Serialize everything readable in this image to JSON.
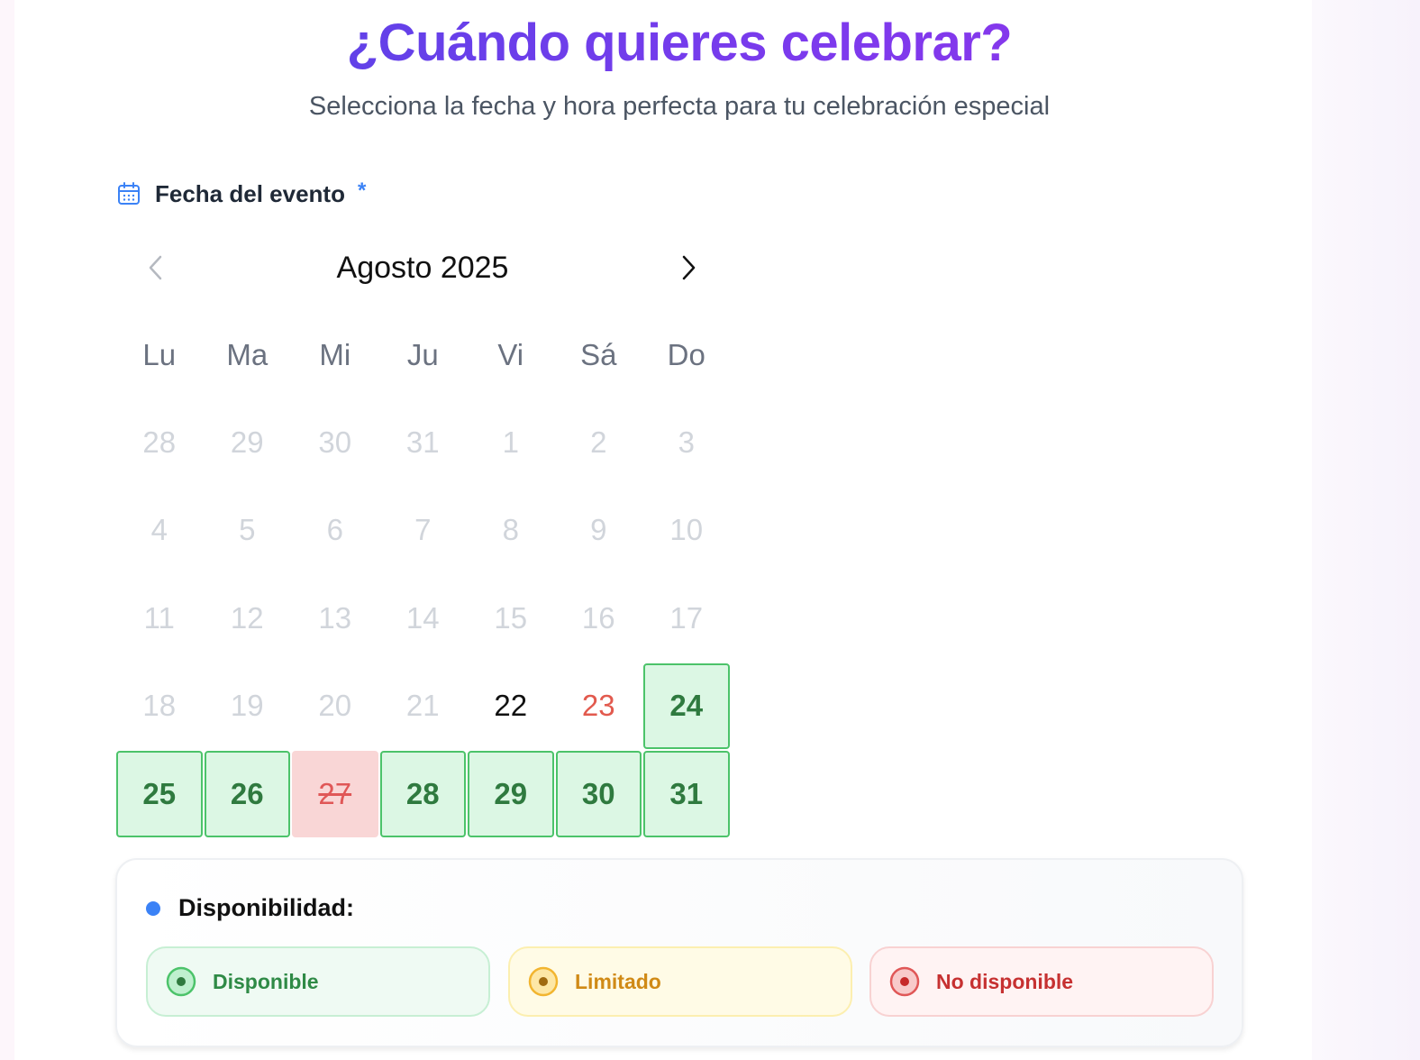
{
  "header": {
    "title": "¿Cuándo quieres celebrar?",
    "subtitle": "Selecciona la fecha y hora perfecta para tu celebración especial"
  },
  "date_field": {
    "icon": "calendar-icon",
    "label": "Fecha del evento",
    "required_marker": "*"
  },
  "calendar": {
    "month_label": "Agosto 2025",
    "prev_icon": "chevron-left-icon",
    "next_icon": "chevron-right-icon",
    "weekdays": [
      "Lu",
      "Ma",
      "Mi",
      "Ju",
      "Vi",
      "Sá",
      "Do"
    ],
    "days": [
      {
        "label": "28",
        "state": "past"
      },
      {
        "label": "29",
        "state": "past"
      },
      {
        "label": "30",
        "state": "past"
      },
      {
        "label": "31",
        "state": "past"
      },
      {
        "label": "1",
        "state": "past"
      },
      {
        "label": "2",
        "state": "past"
      },
      {
        "label": "3",
        "state": "past"
      },
      {
        "label": "4",
        "state": "past"
      },
      {
        "label": "5",
        "state": "past"
      },
      {
        "label": "6",
        "state": "past"
      },
      {
        "label": "7",
        "state": "past"
      },
      {
        "label": "8",
        "state": "past"
      },
      {
        "label": "9",
        "state": "past"
      },
      {
        "label": "10",
        "state": "past"
      },
      {
        "label": "11",
        "state": "past"
      },
      {
        "label": "12",
        "state": "past"
      },
      {
        "label": "13",
        "state": "past"
      },
      {
        "label": "14",
        "state": "past"
      },
      {
        "label": "15",
        "state": "past"
      },
      {
        "label": "16",
        "state": "past"
      },
      {
        "label": "17",
        "state": "past"
      },
      {
        "label": "18",
        "state": "past"
      },
      {
        "label": "19",
        "state": "past"
      },
      {
        "label": "20",
        "state": "past"
      },
      {
        "label": "21",
        "state": "past"
      },
      {
        "label": "22",
        "state": "today"
      },
      {
        "label": "23",
        "state": "weekend-red"
      },
      {
        "label": "24",
        "state": "available"
      },
      {
        "label": "25",
        "state": "available"
      },
      {
        "label": "26",
        "state": "available"
      },
      {
        "label": "27",
        "state": "unavailable"
      },
      {
        "label": "28",
        "state": "available"
      },
      {
        "label": "29",
        "state": "available"
      },
      {
        "label": "30",
        "state": "available"
      },
      {
        "label": "31",
        "state": "available"
      }
    ]
  },
  "legend": {
    "title": "Disponibilidad:",
    "items": [
      {
        "label": "Disponible",
        "color": "#4cc36a"
      },
      {
        "label": "Limitado",
        "color": "#f2b530"
      },
      {
        "label": "No disponible",
        "color": "#e05757"
      }
    ]
  },
  "colors": {
    "title_gradient_start": "#4f46e5",
    "title_gradient_end": "#9333ea",
    "accent": "#3b82f6"
  }
}
